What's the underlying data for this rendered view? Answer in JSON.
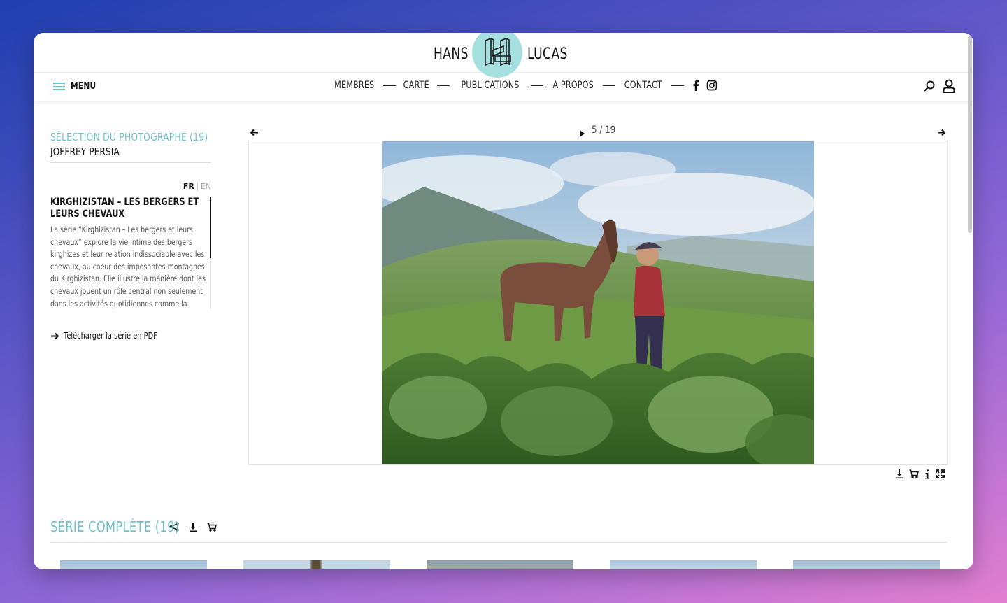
{
  "brand": {
    "left": "HANS",
    "right": "LUCAS"
  },
  "nav": {
    "menu_label": "MENU",
    "links": [
      "MEMBRES",
      "CARTE",
      "PUBLICATIONS",
      "A PROPOS",
      "CONTACT"
    ]
  },
  "sidebar": {
    "selection_title": "SÉLECTION DU PHOTOGRAPHE (19)",
    "photographer": "JOFFREY PERSIA",
    "lang_fr": "FR",
    "lang_en": "EN",
    "series_title": "KIRGHIZISTAN – LES BERGERS ET LEURS CHEVAUX",
    "series_description": "La série “Kirghizistan – Les bergers et leurs chevaux” explore la vie intime des bergers kirghizes et leur relation indissociable avec les chevaux, au coeur des imposantes montagnes du Kirghizistan. Elle illustre la manière dont les chevaux jouent un rôle central non seulement dans les activités quotidiennes comme la transhumance",
    "pdf_link": "Télécharger la série en PDF"
  },
  "viewer": {
    "counter": "5 / 19"
  },
  "series_complete": {
    "title": "SÉRIE COMPLÈTE (19)"
  },
  "colors": {
    "accent": "#6ec4c9",
    "logo_circle": "#a6dfe0",
    "text": "#111111"
  },
  "icons": {
    "nav": [
      "facebook-icon",
      "instagram-icon",
      "search-icon",
      "user-icon"
    ],
    "viewer": [
      "arrow-left-icon",
      "play-icon",
      "arrow-right-icon",
      "download-icon",
      "cart-icon",
      "info-icon",
      "fullscreen-icon"
    ],
    "series": [
      "share-icon",
      "download-icon",
      "cart-icon"
    ]
  }
}
